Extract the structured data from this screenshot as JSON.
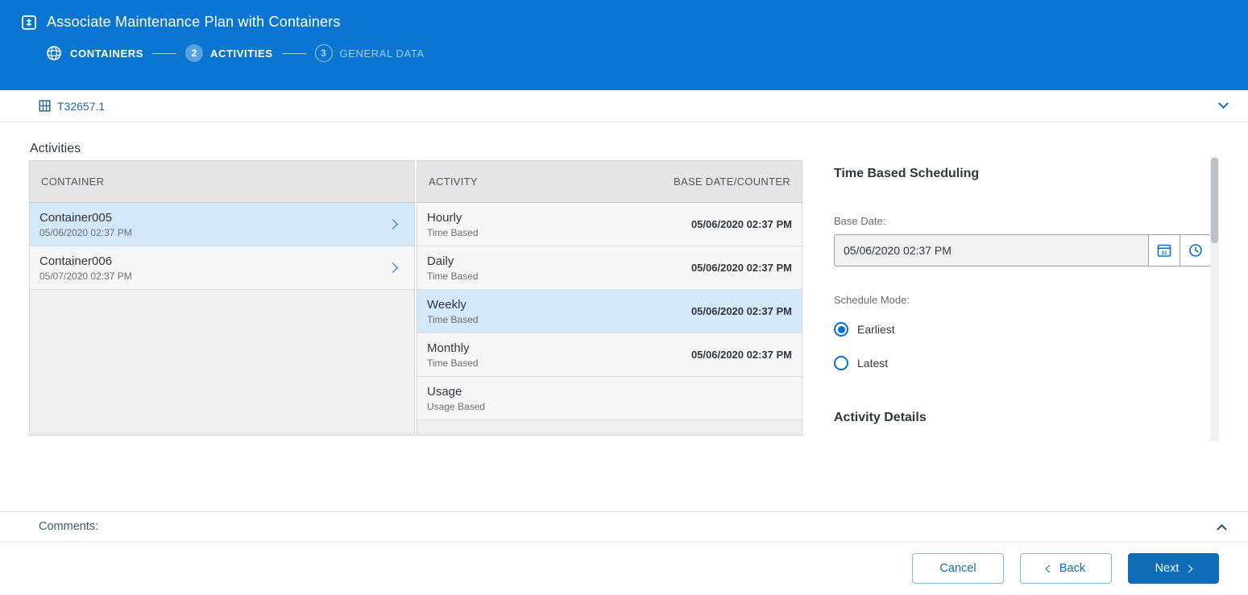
{
  "header": {
    "title": "Associate Maintenance Plan with Containers",
    "steps": [
      {
        "label": "CONTAINERS",
        "state": "current-done",
        "icon": "containers-step-icon"
      },
      {
        "number": "2",
        "label": "ACTIVITIES",
        "state": "active"
      },
      {
        "number": "3",
        "label": "GENERAL DATA",
        "state": "upcoming"
      }
    ]
  },
  "subheader": {
    "plan_id": "T32657.1",
    "icon": "container-icon",
    "collapse_icon": "chevron-down-icon"
  },
  "activities": {
    "section_title": "Activities",
    "container_table": {
      "header": "CONTAINER",
      "rows": [
        {
          "name": "Container005",
          "date": "05/06/2020 02:37 PM",
          "selected": true
        },
        {
          "name": "Container006",
          "date": "05/07/2020 02:37 PM",
          "selected": false
        }
      ]
    },
    "activity_table": {
      "headers": [
        "ACTIVITY",
        "BASE DATE/COUNTER"
      ],
      "rows": [
        {
          "name": "Hourly",
          "type": "Time Based",
          "date": "05/06/2020 02:37 PM",
          "selected": false
        },
        {
          "name": "Daily",
          "type": "Time Based",
          "date": "05/06/2020 02:37 PM",
          "selected": false
        },
        {
          "name": "Weekly",
          "type": "Time Based",
          "date": "05/06/2020 02:37 PM",
          "selected": true
        },
        {
          "name": "Monthly",
          "type": "Time Based",
          "date": "05/06/2020 02:37 PM",
          "selected": false
        },
        {
          "name": "Usage",
          "type": "Usage Based",
          "date": "",
          "selected": false
        }
      ]
    }
  },
  "details": {
    "title": "Time Based Scheduling",
    "base_date_label": "Base Date:",
    "base_date_value": "05/06/2020 02:37 PM",
    "icons": [
      "calendar-icon",
      "clock-icon"
    ],
    "schedule_mode_label": "Schedule Mode:",
    "modes": [
      {
        "label": "Earliest",
        "selected": true
      },
      {
        "label": "Latest",
        "selected": false
      }
    ],
    "activity_details_title": "Activity Details"
  },
  "comments": {
    "label": "Comments:",
    "collapse_icon": "chevron-up-icon"
  },
  "footer": {
    "cancel_label": "Cancel",
    "back_label": "Back",
    "next_label": "Next"
  },
  "colors": {
    "header_blue": "#0a76d1",
    "accent_blue": "#0a6ed1",
    "primary_button": "#0f6cb5",
    "selected_row": "#d3e8f8"
  }
}
